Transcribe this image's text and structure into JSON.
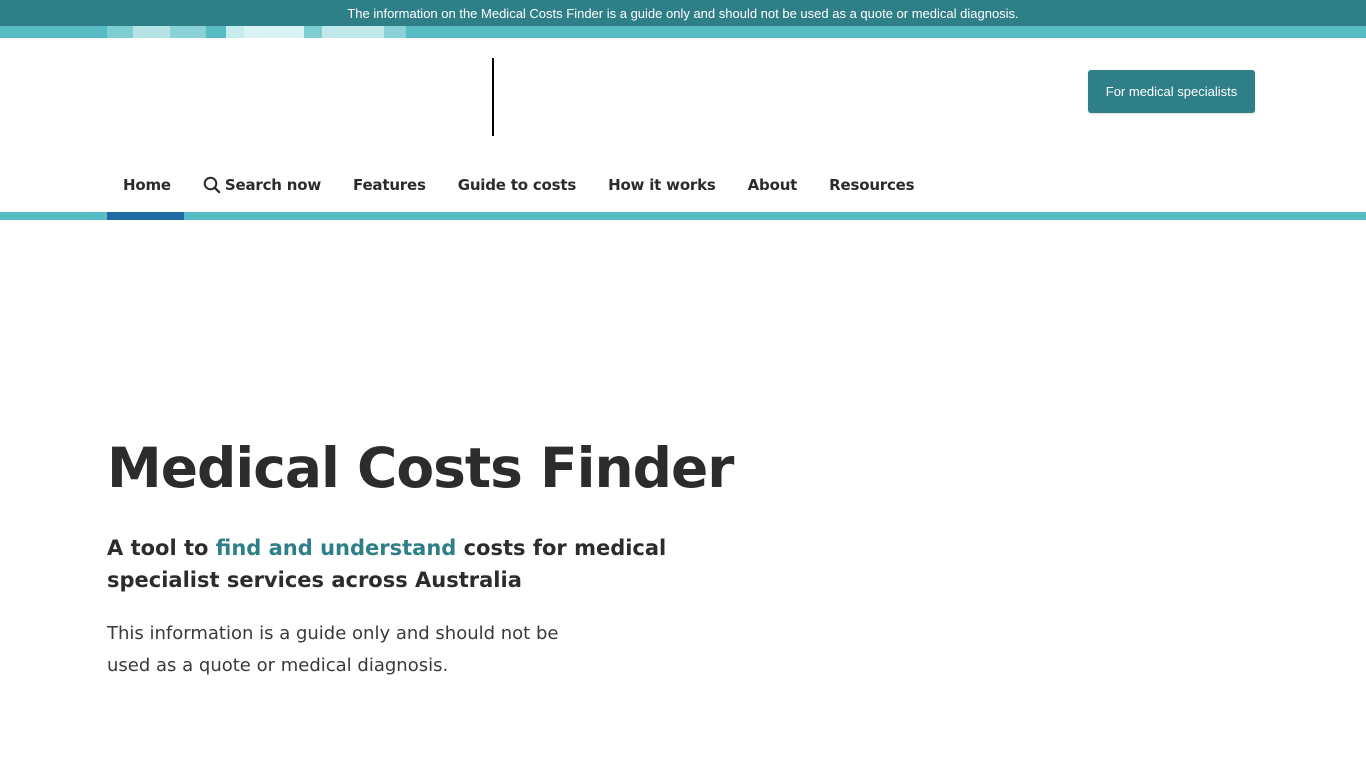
{
  "notice": {
    "text": "The information on the Medical Costs Finder is a guide only and should not be used as a quote or medical diagnosis."
  },
  "header": {
    "specialist_button_label": "For medical specialists"
  },
  "nav": {
    "items": [
      {
        "label": "Home",
        "active": true
      },
      {
        "label": "Search now",
        "icon": "search-icon"
      },
      {
        "label": "Features"
      },
      {
        "label": "Guide to costs"
      },
      {
        "label": "How it works"
      },
      {
        "label": "About"
      },
      {
        "label": "Resources"
      }
    ]
  },
  "hero": {
    "title": "Medical Costs Finder",
    "subtitle_before": "A tool to ",
    "subtitle_highlight": "find and understand",
    "subtitle_after": " costs for medical specialist services across Australia",
    "body": "This information is a guide only and should not be used as a quote or medical diagnosis."
  },
  "colors": {
    "teal_dark": "#2e7f87",
    "teal_light": "#58bcc4",
    "active_blue": "#1f6aa0"
  }
}
